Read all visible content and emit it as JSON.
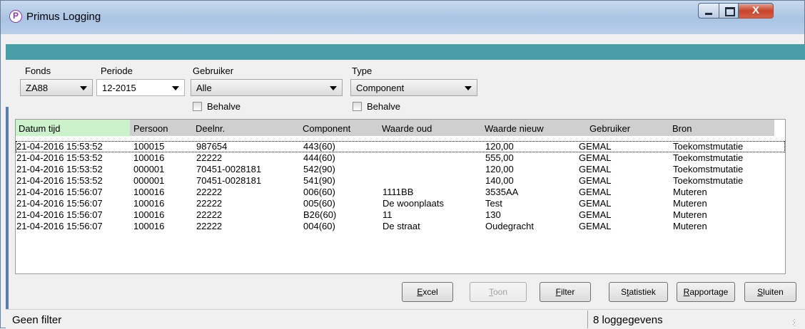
{
  "window": {
    "title": "Primus Logging",
    "app_icon_letter": "P",
    "close_glyph": "X"
  },
  "filters": {
    "fonds": {
      "label": "Fonds",
      "value": "ZA88"
    },
    "periode": {
      "label": "Periode",
      "value": "12-2015"
    },
    "gebruiker": {
      "label": "Gebruiker",
      "value": "Alle",
      "behalve_label": "Behalve"
    },
    "type": {
      "label": "Type",
      "value": "Component",
      "behalve_label": "Behalve"
    }
  },
  "grid": {
    "columns": [
      "Datum tijd",
      "Persoon",
      "Deelnr.",
      "Component",
      "Waarde oud",
      "Waarde nieuw",
      "Gebruiker",
      "Bron"
    ],
    "rows": [
      [
        "21-04-2016 15:53:52",
        "100015",
        "987654",
        "443(60)",
        "",
        "120,00",
        "GEMAL",
        "Toekomstmutatie"
      ],
      [
        "21-04-2016 15:53:52",
        "100016",
        "22222",
        "444(60)",
        "",
        "555,00",
        "GEMAL",
        "Toekomstmutatie"
      ],
      [
        "21-04-2016 15:53:52",
        "000001",
        "70451-0028181",
        "542(90)",
        "",
        "120,00",
        "GEMAL",
        "Toekomstmutatie"
      ],
      [
        "21-04-2016 15:53:52",
        "000001",
        "70451-0028181",
        "541(90)",
        "",
        "140,00",
        "GEMAL",
        "Toekomstmutatie"
      ],
      [
        "21-04-2016 15:56:07",
        "100016",
        "22222",
        "006(60)",
        "1111BB",
        "3535AA",
        "GEMAL",
        "Muteren"
      ],
      [
        "21-04-2016 15:56:07",
        "100016",
        "22222",
        "005(60)",
        "De woonplaats",
        "Test",
        "GEMAL",
        "Muteren"
      ],
      [
        "21-04-2016 15:56:07",
        "100016",
        "22222",
        "B26(60)",
        "11",
        "130",
        "GEMAL",
        "Muteren"
      ],
      [
        "21-04-2016 15:56:07",
        "100016",
        "22222",
        "004(60)",
        "De straat",
        "Oudegracht",
        "GEMAL",
        "Muteren"
      ]
    ]
  },
  "buttons": {
    "excel": {
      "first": "E",
      "rest": "xcel"
    },
    "toon": {
      "first": "T",
      "rest": "oon"
    },
    "filter": {
      "first": "F",
      "rest": "ilter"
    },
    "statistiek": {
      "pre": "S",
      "first": "t",
      "rest": "atistiek"
    },
    "rapportage": {
      "first": "R",
      "rest": "apportage"
    },
    "sluiten": {
      "first": "S",
      "rest": "luiten"
    }
  },
  "status": {
    "left": "Geen filter",
    "right": "8 loggegevens"
  }
}
